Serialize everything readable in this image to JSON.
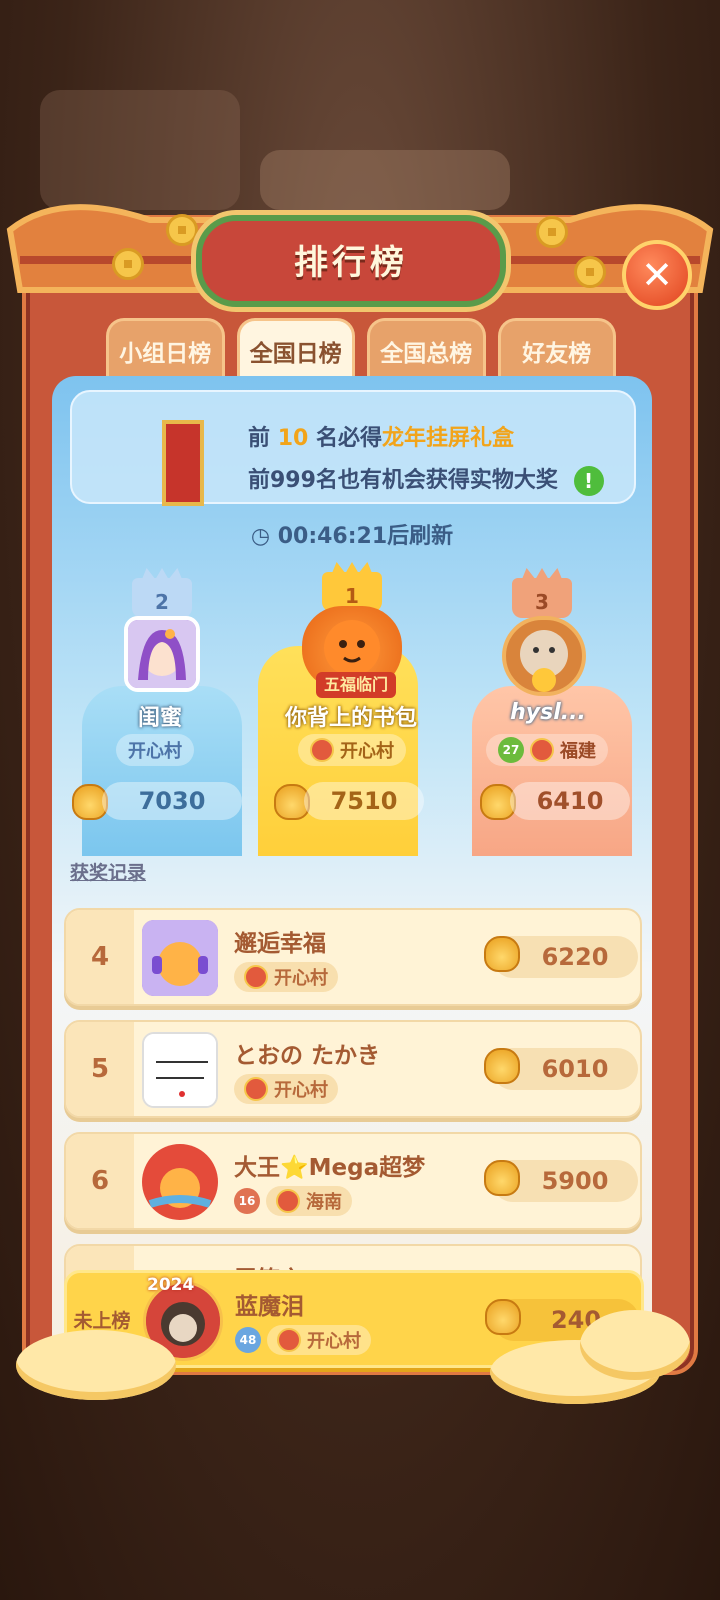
{
  "header": {
    "title": "排行榜"
  },
  "tabs": [
    {
      "label": "小组日榜"
    },
    {
      "label": "全国日榜"
    },
    {
      "label": "全国总榜"
    },
    {
      "label": "好友榜"
    }
  ],
  "info": {
    "line1_prefix": "前",
    "line1_number": "10",
    "line1_middle": "名必得",
    "line1_highlight": "龙年挂屏礼盒",
    "line2": "前999名也有机会获得实物大奖",
    "exclaim": "!"
  },
  "refresh": {
    "text": "00:46:21后刷新"
  },
  "podium": {
    "first": {
      "rank": "1",
      "name": "你背上的书包",
      "avatar_label": "五福临门",
      "region": "开心村",
      "score": "7510"
    },
    "second": {
      "rank": "2",
      "name": "闺蜜",
      "region": "开心村",
      "score": "7030"
    },
    "third": {
      "rank": "3",
      "name": "hysl...",
      "level": "27",
      "region": "福建",
      "score": "6410"
    }
  },
  "history_link": "获奖记录",
  "ranks": [
    {
      "rank": "4",
      "name": "邂逅幸福",
      "region": "开心村",
      "score": "6220",
      "level": ""
    },
    {
      "rank": "5",
      "name": "とおの たかき",
      "region": "开心村",
      "score": "6010",
      "level": ""
    },
    {
      "rank": "6",
      "name": "大王⭐Mega超梦",
      "region": "海南",
      "score": "5900",
      "level": "16"
    },
    {
      "rank": "",
      "name": "吾笑之",
      "region": "",
      "score": "",
      "level": ""
    }
  ],
  "me": {
    "rank": "未上榜",
    "name": "蓝魔泪",
    "level": "48",
    "region": "开心村",
    "score": "240",
    "avatar_label": "2024"
  },
  "colors": {
    "frame": "#c8573a",
    "accent": "#f2a41a",
    "gold": "#ffd44a"
  }
}
